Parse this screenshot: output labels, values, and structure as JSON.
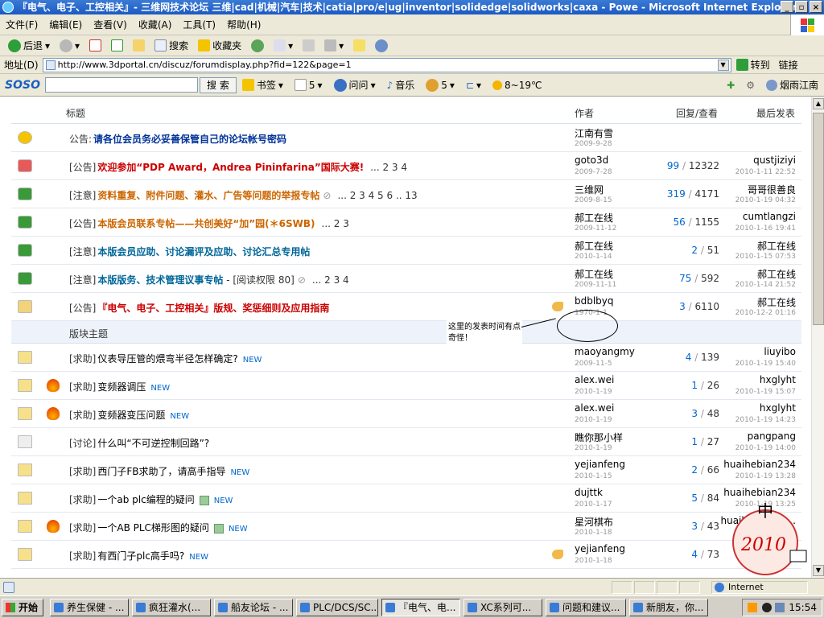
{
  "window": {
    "title": "『电气、电子、工控相关』- 三维网技术论坛 三维|cad|机械|汽车|技术|catia|pro/e|ug|inventor|solidedge|solidworks|caxa - Powe - Microsoft Internet Explorer"
  },
  "menu": [
    "文件(F)",
    "编辑(E)",
    "查看(V)",
    "收藏(A)",
    "工具(T)",
    "帮助(H)"
  ],
  "toolbar": {
    "back": "后退",
    "search": "搜索",
    "favorites": "收藏夹"
  },
  "address": {
    "label": "地址(D)",
    "url": "http://www.3dportal.cn/discuz/forumdisplay.php?fid=122&page=1",
    "go": "转到",
    "links": "链接"
  },
  "soso": {
    "logo": "SOSO",
    "search_btn": "搜 索",
    "bookmarks": "书签",
    "mail_count": "5",
    "ask": "问问",
    "music": "音乐",
    "game_count": "5",
    "weather": "8~19℃",
    "city": "烟雨江南"
  },
  "table": {
    "col_title": "标题",
    "col_author": "作者",
    "col_reply": "回复/查看",
    "col_last": "最后发表",
    "section_label": "版块主题"
  },
  "rows": [
    {
      "icon": "announce",
      "tag": "公告:",
      "title": "请各位会员务必妥善保管自己的论坛帐号密码",
      "title_color": "blue",
      "pages": "",
      "author": "江南有雪",
      "date": "2009-9-28",
      "replies": "",
      "views": "",
      "last_user": "",
      "last_time": ""
    },
    {
      "icon": "up3",
      "tag": "[公告]",
      "title": "欢迎参加“PDP Award，Andrea Pininfarina”国际大赛!",
      "title_color": "red",
      "pages": "... 2 3 4",
      "author": "goto3d",
      "date": "2009-7-28",
      "replies": "99",
      "views": "12322",
      "last_user": "qustjiziyi",
      "last_time": "2010-1-11 22:52"
    },
    {
      "icon": "up1",
      "tag": "[注意]",
      "title": "资料重复、附件问题、灌水、广告等问题的举报专帖",
      "title_color": "orange",
      "pages": "... 2 3 4 5 6 .. 13",
      "attach": true,
      "author": "三维网",
      "date": "2009-8-15",
      "replies": "319",
      "views": "4171",
      "last_user": "哥哥很善良",
      "last_time": "2010-1-19 04:32"
    },
    {
      "icon": "up1",
      "tag": "[公告]",
      "title": "本版会员联系专帖——共创美好“加”园(＊6SWB)",
      "title_color": "orange",
      "pages": "... 2 3",
      "author": "郝工在线",
      "date": "2009-11-12",
      "replies": "56",
      "views": "1155",
      "last_user": "cumtlangzi",
      "last_time": "2010-1-16 19:41"
    },
    {
      "icon": "up1",
      "tag": "[注意]",
      "title": "本版会员应助、讨论漏评及应助、讨论汇总专用帖",
      "title_color": "teal",
      "pages": "",
      "author": "郝工在线",
      "date": "2010-1-14",
      "replies": "2",
      "views": "51",
      "last_user": "郝工在线",
      "last_time": "2010-1-15 07:53"
    },
    {
      "icon": "up1",
      "tag": "[注意]",
      "title": "本版版务、技术管理议事专帖",
      "title_color": "teal",
      "extra": " - [阅读权限 80]",
      "pages": "... 2 3 4",
      "attach": true,
      "author": "郝工在线",
      "date": "2009-11-11",
      "replies": "75",
      "views": "592",
      "last_user": "郝工在线",
      "last_time": "2010-1-14 21:52"
    },
    {
      "icon": "lock",
      "tag": "[公告]",
      "title": "『电气、电子、工控相关』版规、奖惩细则及应用指南",
      "title_color": "red",
      "pages": "",
      "hand": true,
      "author": "bdblbyq",
      "date": "1970-1-1",
      "replies": "3",
      "views": "6110",
      "last_user": "郝工在线",
      "last_time": "2010-12-2 01:16"
    }
  ],
  "threads": [
    {
      "icon": "folder",
      "fire": false,
      "tag": "[求助]",
      "title": "仪表导压管的煨弯半径怎样确定?",
      "new": "NEW",
      "author": "maoyangmy",
      "date": "2009-11-5",
      "replies": "4",
      "views": "139",
      "last_user": "liuyibo",
      "last_time": "2010-1-19 15:40"
    },
    {
      "icon": "folder",
      "fire": true,
      "tag": "[求助]",
      "title": "变频器调压",
      "new": "NEW",
      "author": "alex.wei",
      "date": "2010-1-19",
      "replies": "1",
      "views": "26",
      "last_user": "hxglyht",
      "last_time": "2010-1-19 15:07"
    },
    {
      "icon": "folder",
      "fire": true,
      "tag": "[求助]",
      "title": "变频器变压问题",
      "new": "NEW",
      "author": "alex.wei",
      "date": "2010-1-19",
      "replies": "3",
      "views": "48",
      "last_user": "hxglyht",
      "last_time": "2010-1-19 14:23"
    },
    {
      "icon": "folder-grey",
      "fire": false,
      "tag": "[讨论]",
      "title": "什么叫“不可逆控制回路”?",
      "new": "",
      "author": "瞧你那小样",
      "date": "2010-1-19",
      "replies": "1",
      "views": "27",
      "last_user": "pangpang",
      "last_time": "2010-1-19 14:00"
    },
    {
      "icon": "folder",
      "fire": false,
      "tag": "[求助]",
      "title": "西门子FB求助了，请高手指导",
      "new": "NEW",
      "author": "yejianfeng",
      "date": "2010-1-15",
      "replies": "2",
      "views": "66",
      "last_user": "huaihebian234",
      "last_time": "2010-1-19 13:28"
    },
    {
      "icon": "folder",
      "fire": false,
      "tag": "[求助]",
      "title": "一个ab plc编程的疑问",
      "img": true,
      "new": "NEW",
      "author": "dujttk",
      "date": "2010-1-17",
      "replies": "5",
      "views": "84",
      "last_user": "huaihebian234",
      "last_time": "2010-1-19 13:25"
    },
    {
      "icon": "folder",
      "fire": true,
      "tag": "[求助]",
      "title": "一个AB PLC梯形图的疑问",
      "img": true,
      "new": "NEW",
      "author": "星河棋布",
      "date": "2010-1-18",
      "replies": "3",
      "views": "43",
      "last_user": "huaihebian23...",
      "last_time": "2010-1-19 ..."
    },
    {
      "icon": "folder",
      "fire": false,
      "tag": "[求助]",
      "title": "有西门子plc高手吗?",
      "new": "NEW",
      "hand": true,
      "author": "yejianfeng",
      "date": "2010-1-18",
      "replies": "4",
      "views": "73",
      "last_user": "",
      "last_time": ""
    }
  ],
  "annotation": {
    "text": "这里的发表时间有点奇怪！"
  },
  "stamp": {
    "text": "2010"
  },
  "status": {
    "zone": "Internet"
  },
  "taskbar": {
    "start": "开始",
    "tasks": [
      "养生保健 - ...",
      "疯狂灌水(...",
      "船友论坛 - ...",
      "PLC/DCS/SC...",
      "『电气、电...",
      "XC系列可...",
      "问题和建议...",
      "新朋友，你..."
    ],
    "clock": "15:54"
  }
}
